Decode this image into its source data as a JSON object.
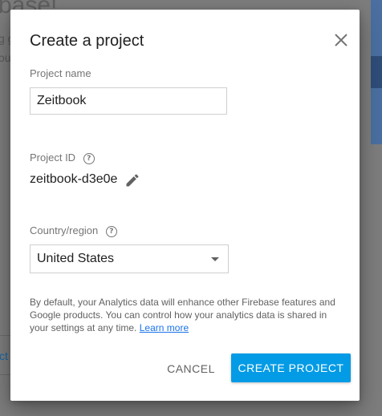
{
  "background": {
    "heading_fragment": "base!",
    "line1_fragment": "g g",
    "line2_fragment": "ou",
    "button_fragment": "ct"
  },
  "dialog": {
    "title": "Create a project",
    "close_icon": "close-icon",
    "project_name": {
      "label": "Project name",
      "value": "Zeitbook"
    },
    "project_id": {
      "label": "Project ID",
      "value": "zeitbook-d3e0e",
      "help_icon": "help-icon",
      "edit_icon": "pencil-icon"
    },
    "country": {
      "label": "Country/region",
      "selected": "United States",
      "help_icon": "help-icon"
    },
    "disclaimer": "By default, your Analytics data will enhance other Firebase features and Google products. You can control how your analytics data is shared in your settings at any time.",
    "learn_more": "Learn more",
    "cancel_label": "CANCEL",
    "create_label": "CREATE PROJECT"
  },
  "colors": {
    "primary": "#039be5",
    "link": "#1a73e8",
    "overlay": "#7d7d7d"
  }
}
